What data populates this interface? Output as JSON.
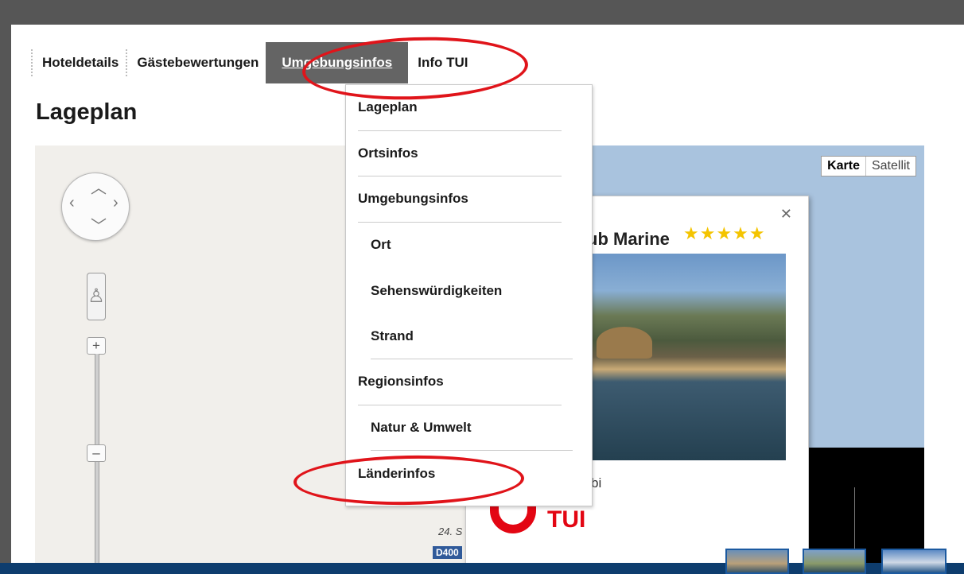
{
  "nav": {
    "items": [
      "Hoteldetails",
      "Gästebewertungen",
      "Umgebungsinfos",
      "Info TUI"
    ],
    "active": "Umgebungsinfos"
  },
  "page_title": "Lageplan",
  "map": {
    "type_buttons": {
      "map": "Karte",
      "satellite": "Satellit"
    },
    "road_label": "24. S",
    "road_badge": "D400"
  },
  "info_window": {
    "hotel_name": "ub Marine",
    "stars": "★★★★★",
    "city": "bi",
    "logo_text": "TUI",
    "close_icon": "close-icon"
  },
  "dropdown": {
    "items": [
      "Lageplan",
      "Ortsinfos",
      "Umgebungsinfos",
      "Ort",
      "Sehenswürdigkeiten",
      "Strand",
      "Regionsinfos",
      "Natur & Umwelt",
      "Länderinfos"
    ]
  },
  "colors": {
    "nav_active_bg": "#646464",
    "annotation": "#e0141a",
    "water": "#a9c3de",
    "tui_red": "#e30613"
  }
}
